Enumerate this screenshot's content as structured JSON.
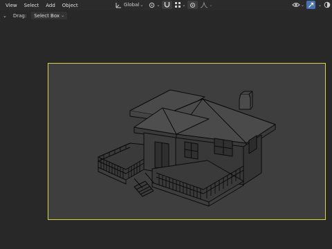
{
  "menu": {
    "items": [
      "View",
      "Select",
      "Add",
      "Object"
    ]
  },
  "toolbar": {
    "orientation": {
      "label": "Global",
      "icon": "transform-orientation-icon"
    },
    "pivot_icon": "pivot-point-icon",
    "snap_icon": "magnet-snap-icon",
    "snap_target_icon": "snap-target-icon",
    "proportional_icon": "proportional-editing-icon",
    "falloff_icon": "falloff-curve-icon"
  },
  "right_tools": {
    "visibility_icon": "visibility-icon",
    "gizmo_icon": "gizmo-icon",
    "overlay_icon": "overlay-icon"
  },
  "subheader": {
    "mode_toggle": "⌄",
    "drag_label": "Drag:",
    "drag_value": "Select Box"
  },
  "colors": {
    "accent": "#4772b3",
    "camera_frame": "#d8d838",
    "wire": "#000000",
    "viewport_bg": "#282828"
  }
}
